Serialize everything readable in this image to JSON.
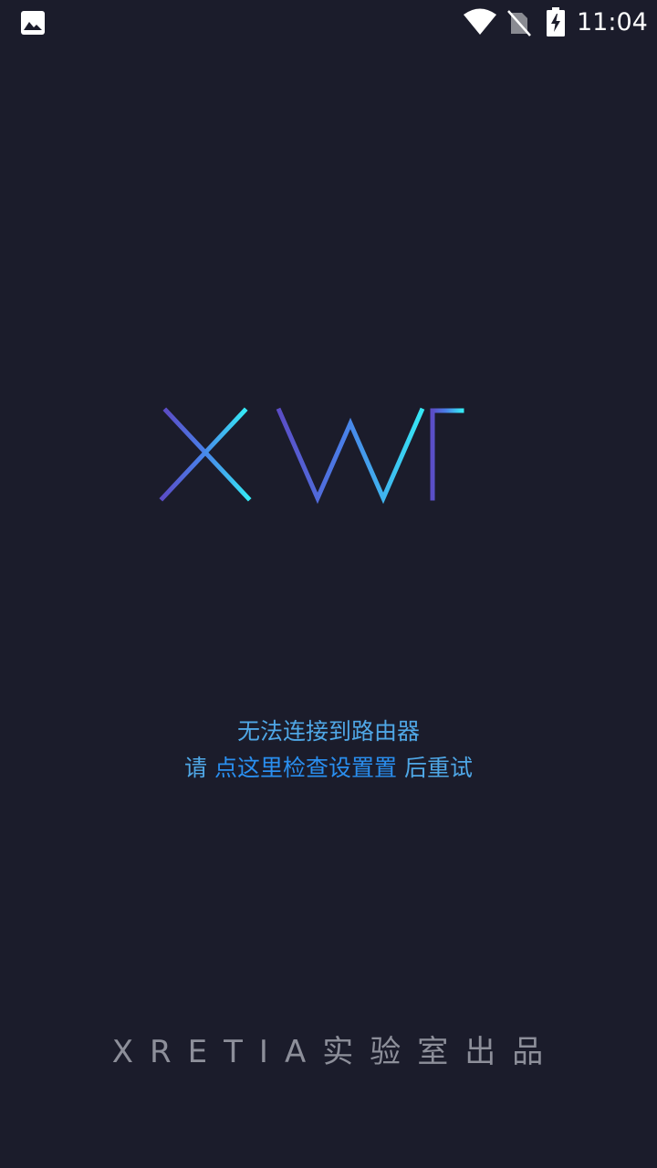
{
  "status_bar": {
    "time": "11:04",
    "icons": [
      "gallery-icon",
      "wifi-icon",
      "no-sim-icon",
      "battery-charging-icon"
    ]
  },
  "logo": {
    "text": "X-WiFi",
    "gradient_start": "#5a4fc9",
    "gradient_end": "#36e6f5"
  },
  "message": {
    "line1": "无法连接到路由器",
    "line2_prefix": "请 ",
    "line2_link": "点这里检查设置置",
    "line2_suffix": " 后重试"
  },
  "credit": {
    "text": "XRETIA实验室出品"
  },
  "colors": {
    "background": "#1b1c2b",
    "message_text": "#4fa7e6",
    "link": "#2a8ff0",
    "credit": "#8d8f9a"
  }
}
